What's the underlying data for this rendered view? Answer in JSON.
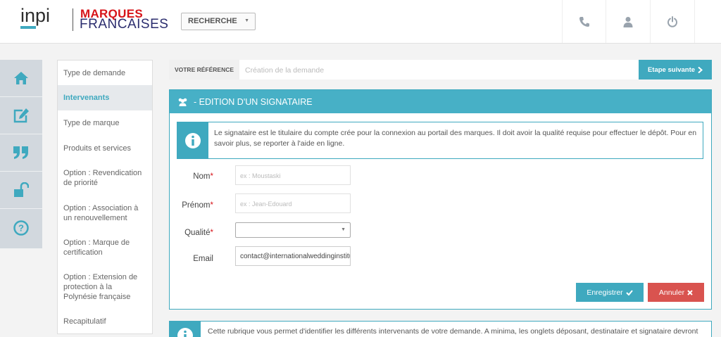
{
  "header": {
    "logo_text": "inpi",
    "brand_line1": "MARQUES",
    "brand_line2": "FRANCAISES",
    "search_select": "RECHERCHE",
    "icons": [
      "phone-icon",
      "user-icon",
      "power-icon"
    ]
  },
  "leftnav": {
    "icons": [
      "home-icon",
      "edit-icon",
      "quote-icon",
      "unlock-icon",
      "help-icon"
    ]
  },
  "sidemenu": {
    "items": [
      {
        "label": "Type de demande",
        "active": false
      },
      {
        "label": "Intervenants",
        "active": true
      },
      {
        "label": "Type de marque",
        "active": false
      },
      {
        "label": "Produits et services",
        "active": false
      },
      {
        "label": "Option : Revendication de priorité",
        "active": false
      },
      {
        "label": "Option : Association à un renouvellement",
        "active": false
      },
      {
        "label": "Option : Marque de certification",
        "active": false
      },
      {
        "label": "Option : Extension de protection à la Polynésie française",
        "active": false
      },
      {
        "label": "Recapitulatif",
        "active": false
      }
    ]
  },
  "refbar": {
    "label": "VOTRE RÉFÉRENCE",
    "placeholder": "Création de la demande",
    "next_label": "Etape suivante"
  },
  "panel": {
    "title": "- EDITION D'UN SIGNATAIRE",
    "info": "Le signataire est le titulaire du compte crée pour la connexion au portail des marques. Il doit avoir la qualité requise pour effectuer le dépôt. Pour en savoir plus, se reporter à l'aide en ligne.",
    "form": {
      "nom_label": "Nom",
      "nom_placeholder": "ex : Moustaski",
      "prenom_label": "Prénom",
      "prenom_placeholder": "ex : Jean-Edouard",
      "qualite_label": "Qualité",
      "qualite_value": "",
      "email_label": "Email",
      "email_value": "contact@internationalweddinginstitute"
    },
    "save_label": "Enregistrer",
    "cancel_label": "Annuler"
  },
  "bottom_info": {
    "text": "Cette rubrique vous permet d'identifier les différents intervenants de votre demande. A minima, les onglets déposant, destinataire et signataire devront"
  },
  "colors": {
    "accent": "#3fa9bf",
    "danger": "#d9534f",
    "brand_red": "#d7141a",
    "brand_navy": "#2b2d6e"
  }
}
